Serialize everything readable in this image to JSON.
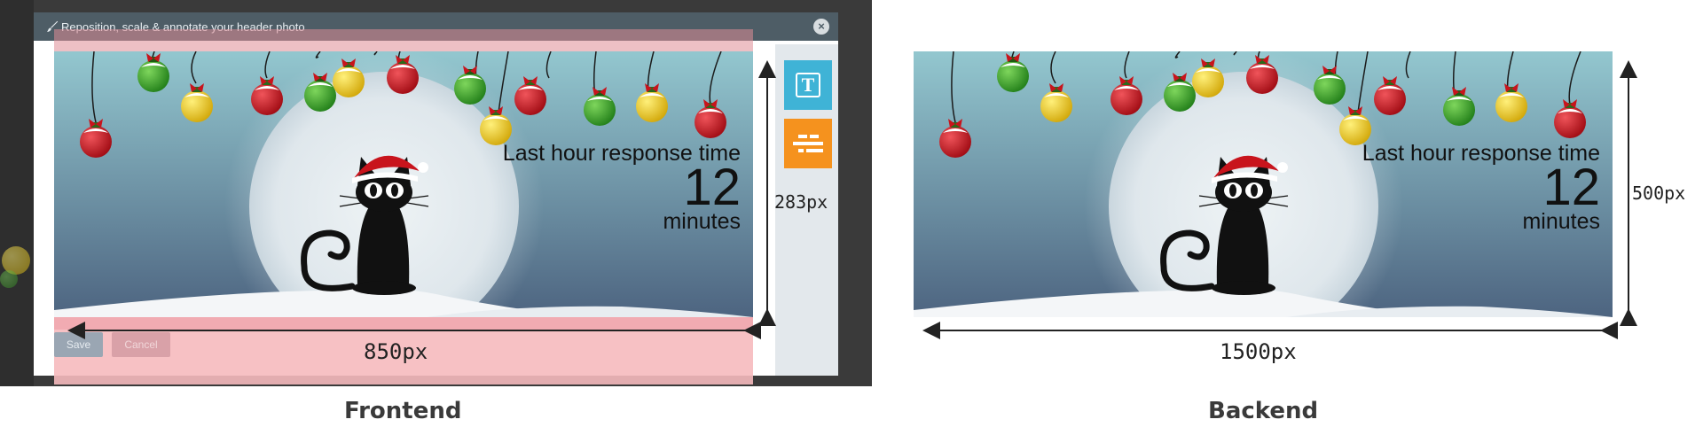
{
  "dialog": {
    "title": "Reposition, scale & annotate your header photo",
    "close_symbol": "×",
    "save_label": "Save",
    "cancel_label": "Cancel",
    "tools": [
      {
        "name": "text-tool",
        "icon": "text-T-icon",
        "glyph": "T",
        "color": "#3fb3d6"
      },
      {
        "name": "layout-tool",
        "icon": "align-bars-icon",
        "color": "#f5921e"
      }
    ]
  },
  "banner": {
    "label": "Last hour response time",
    "value": "12",
    "unit": "minutes"
  },
  "frontend": {
    "section_label": "Frontend",
    "width_label": "850px",
    "height_label": "283px"
  },
  "backend": {
    "section_label": "Backend",
    "width_label": "1500px",
    "height_label": "500px"
  },
  "colors": {
    "sky_top": "#8fc3cc",
    "sky_bottom": "#4f6680",
    "moon": "#e6edf1",
    "ornament_red": "#c8141c",
    "ornament_green": "#3a9a2a",
    "ornament_yellow": "#e8c51a",
    "accent_blue": "#3fb3d6",
    "accent_orange": "#f5921e"
  }
}
